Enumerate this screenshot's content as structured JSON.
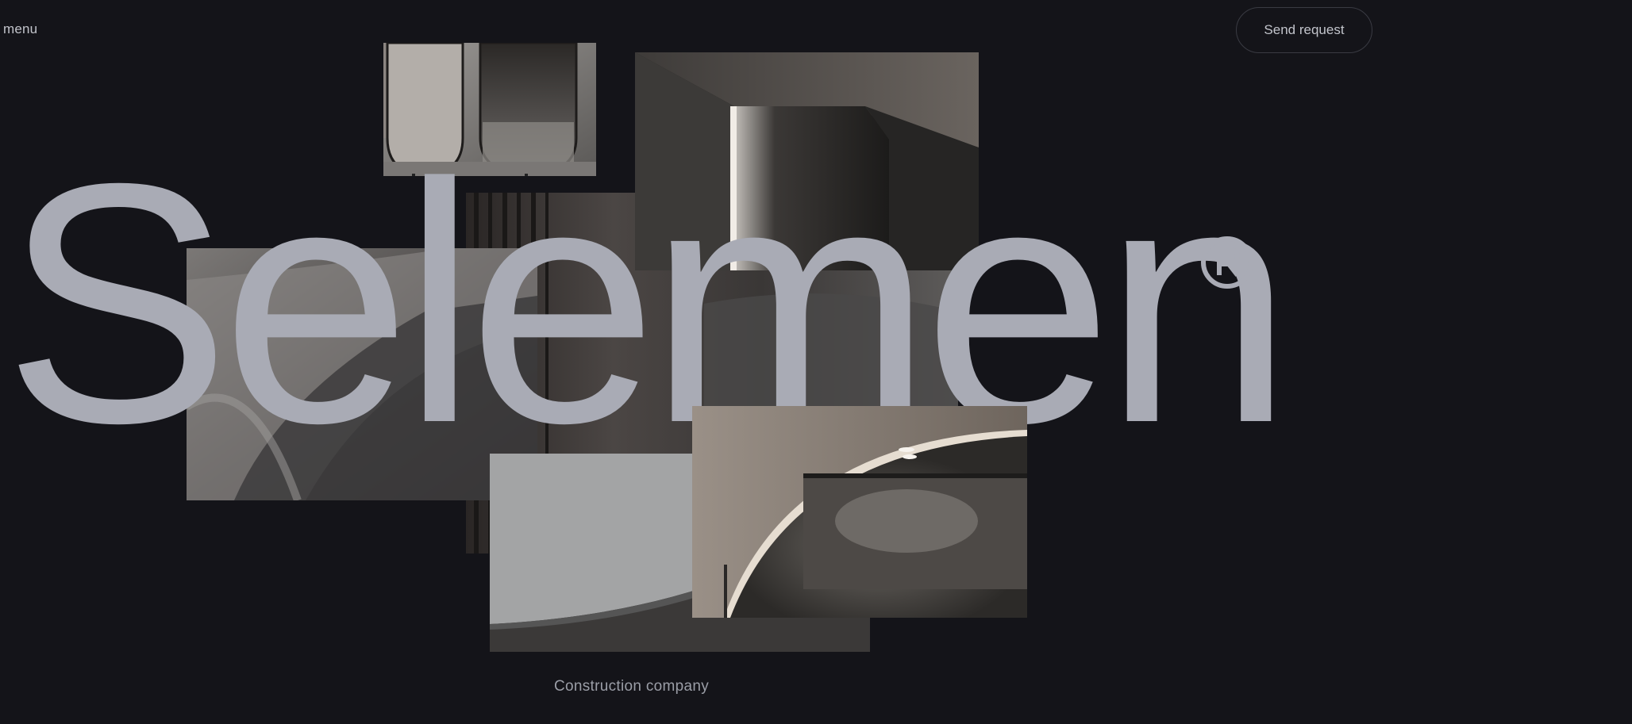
{
  "header": {
    "menu_label": "menu",
    "send_request_label": "Send request"
  },
  "hero": {
    "wordmark": "Selemen",
    "registered_symbol": "registered-icon",
    "tagline": "Construction company"
  },
  "gallery": {
    "images": [
      "photo-arched-mirrors",
      "photo-lit-corridor-corner",
      "photo-dark-curtain-room",
      "photo-curved-wall-detail",
      "photo-plaster-curve",
      "photo-arched-ceiling-light"
    ]
  },
  "colors": {
    "background": "#141419",
    "wordmark": "#a9abb5",
    "text": "#c2c4cb",
    "border": "#3a3b43"
  }
}
